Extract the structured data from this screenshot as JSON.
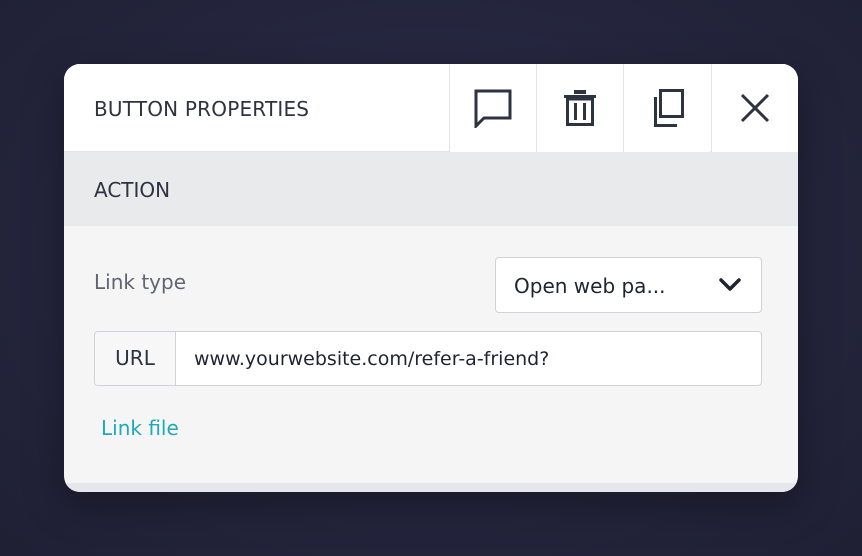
{
  "header": {
    "title": "BUTTON PROPERTIES",
    "actions": [
      {
        "icon": "comment-icon"
      },
      {
        "icon": "trash-icon"
      },
      {
        "icon": "copy-icon"
      },
      {
        "icon": "close-icon"
      }
    ]
  },
  "section": {
    "title": "ACTION"
  },
  "link_type": {
    "label": "Link type",
    "selected": "Open web pa...",
    "chevron_icon": "chevron-down-icon"
  },
  "url": {
    "label": "URL",
    "value": "www.yourwebsite.com/refer-a-friend?"
  },
  "link_file": {
    "label": "Link file"
  },
  "colors": {
    "accent": "#1fa9b8",
    "panel": "#f5f5f5",
    "header": "#ffffff",
    "section": "#e9eaec",
    "text": "#2d3340"
  }
}
